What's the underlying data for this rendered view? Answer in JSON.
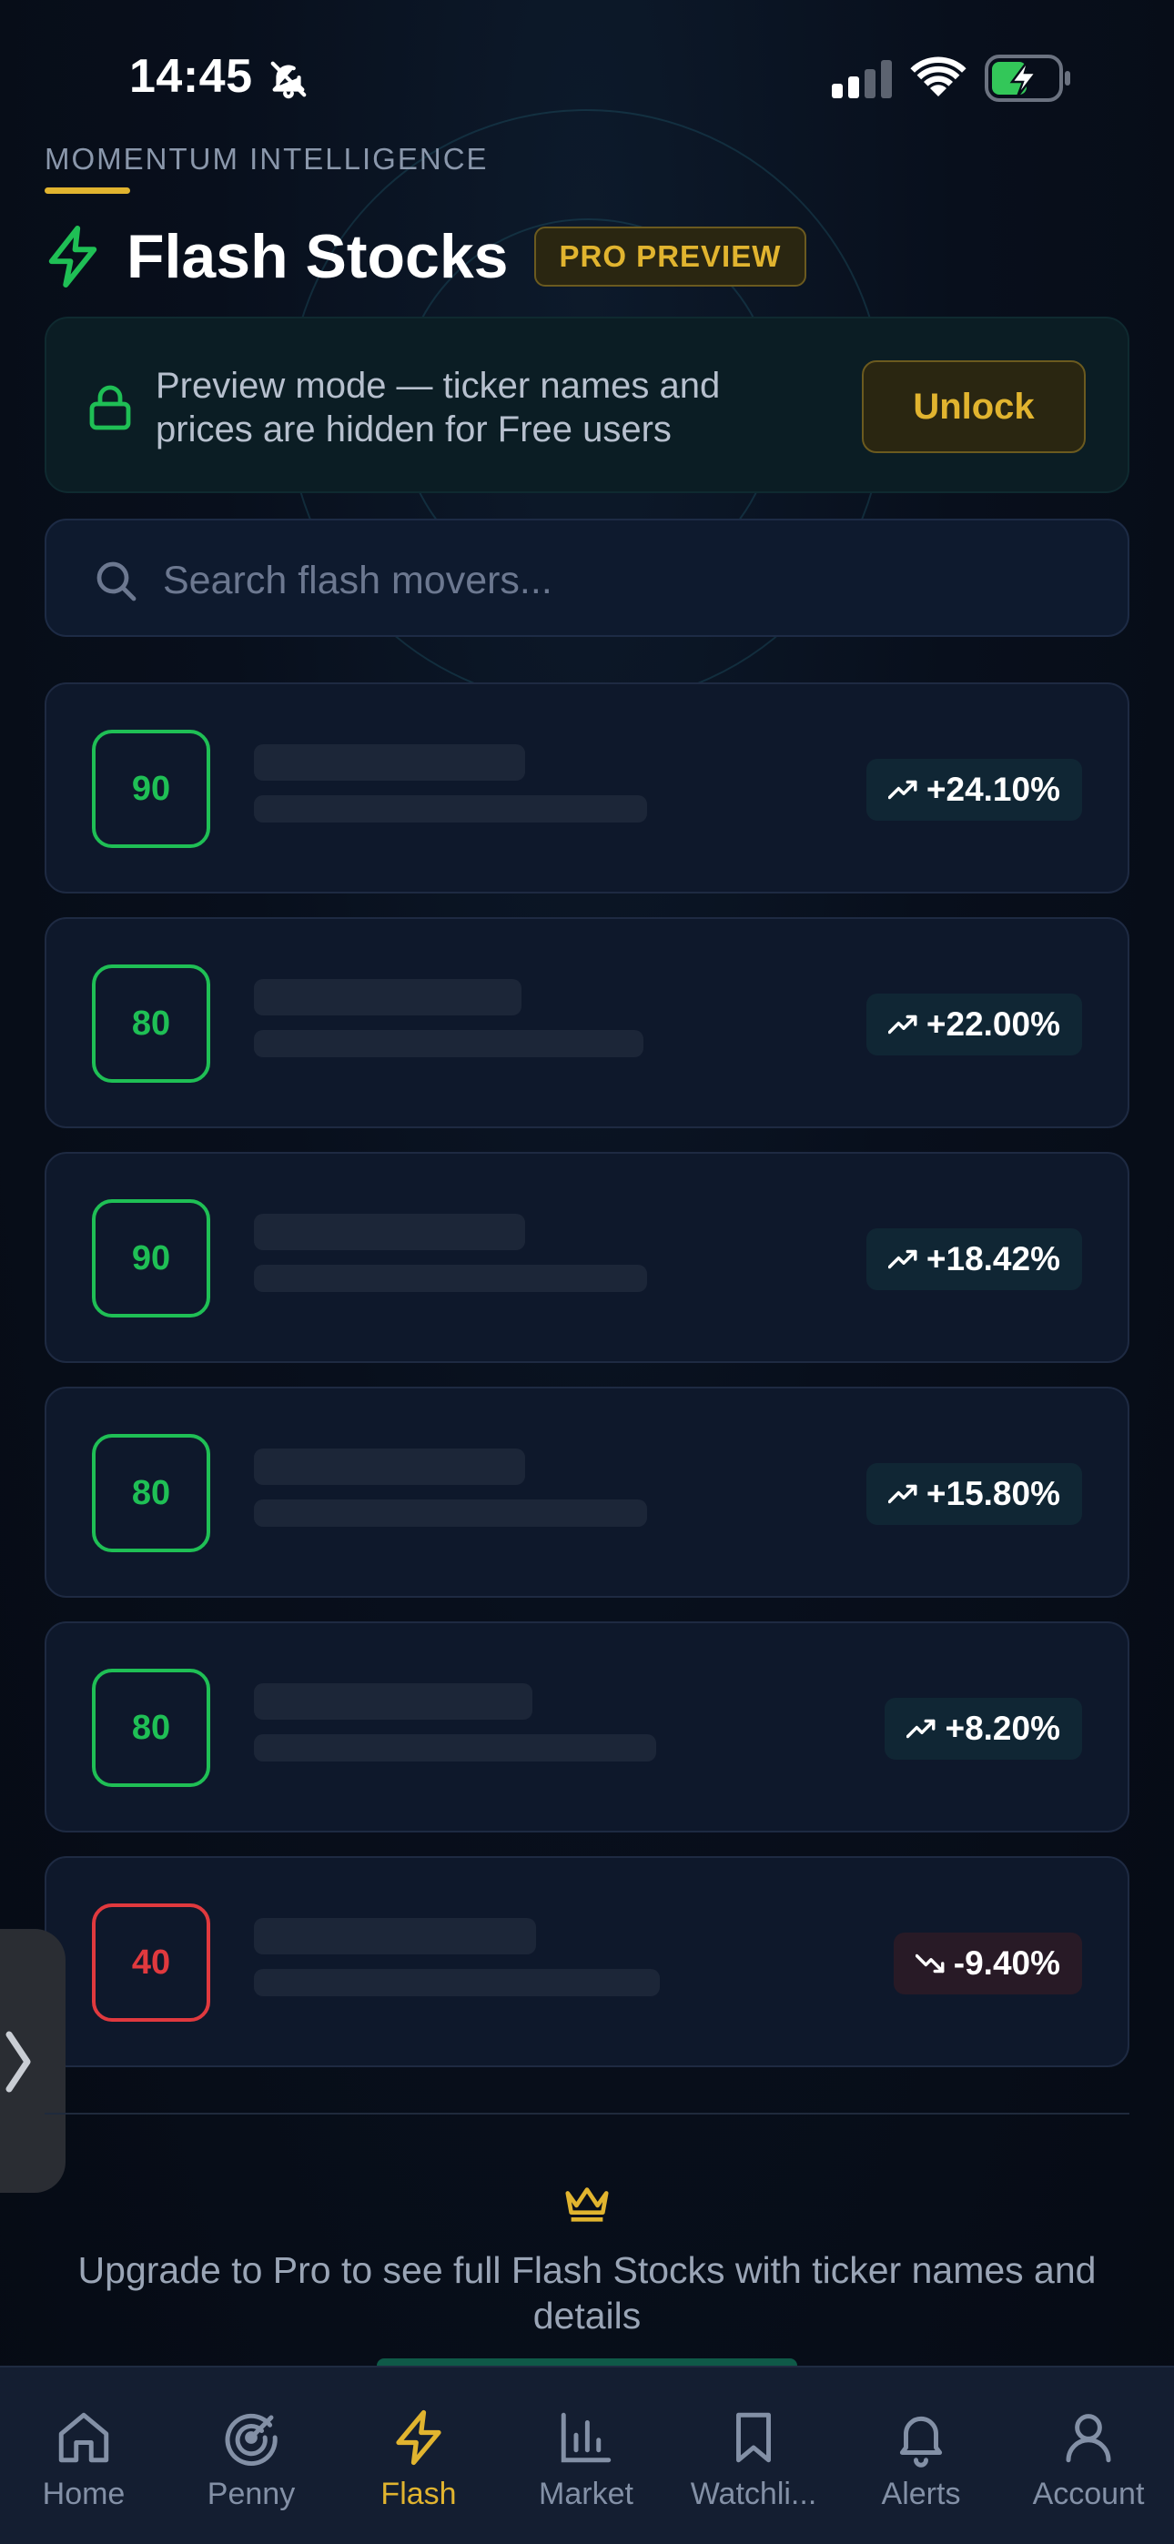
{
  "status_bar": {
    "time": "14:45"
  },
  "header": {
    "eyebrow": "MOMENTUM INTELLIGENCE",
    "title": "Flash Stocks",
    "badge": "PRO PREVIEW"
  },
  "preview_banner": {
    "text": "Preview mode — ticker names and prices are hidden for Free users",
    "unlock_label": "Unlock"
  },
  "search": {
    "placeholder": "Search flash movers..."
  },
  "stocks": [
    {
      "score": "90",
      "change": "+24.10%",
      "direction": "up"
    },
    {
      "score": "80",
      "change": "+22.00%",
      "direction": "up"
    },
    {
      "score": "90",
      "change": "+18.42%",
      "direction": "up"
    },
    {
      "score": "80",
      "change": "+15.80%",
      "direction": "up"
    },
    {
      "score": "80",
      "change": "+8.20%",
      "direction": "up"
    },
    {
      "score": "40",
      "change": "-9.40%",
      "direction": "down"
    }
  ],
  "upgrade": {
    "text": "Upgrade to Pro to see full Flash Stocks with ticker names and details"
  },
  "nav": {
    "items": [
      {
        "label": "Home",
        "icon": "home-icon"
      },
      {
        "label": "Penny",
        "icon": "radar-icon"
      },
      {
        "label": "Flash",
        "icon": "flash-icon",
        "active": true
      },
      {
        "label": "Market",
        "icon": "bar-chart-icon"
      },
      {
        "label": "Watchli...",
        "icon": "bookmark-icon"
      },
      {
        "label": "Alerts",
        "icon": "bell-icon"
      },
      {
        "label": "Account",
        "icon": "user-icon"
      }
    ]
  },
  "colors": {
    "accent": "#e1b42f",
    "positive": "#1fbf55",
    "negative": "#e0393e",
    "background": "#070d18"
  }
}
